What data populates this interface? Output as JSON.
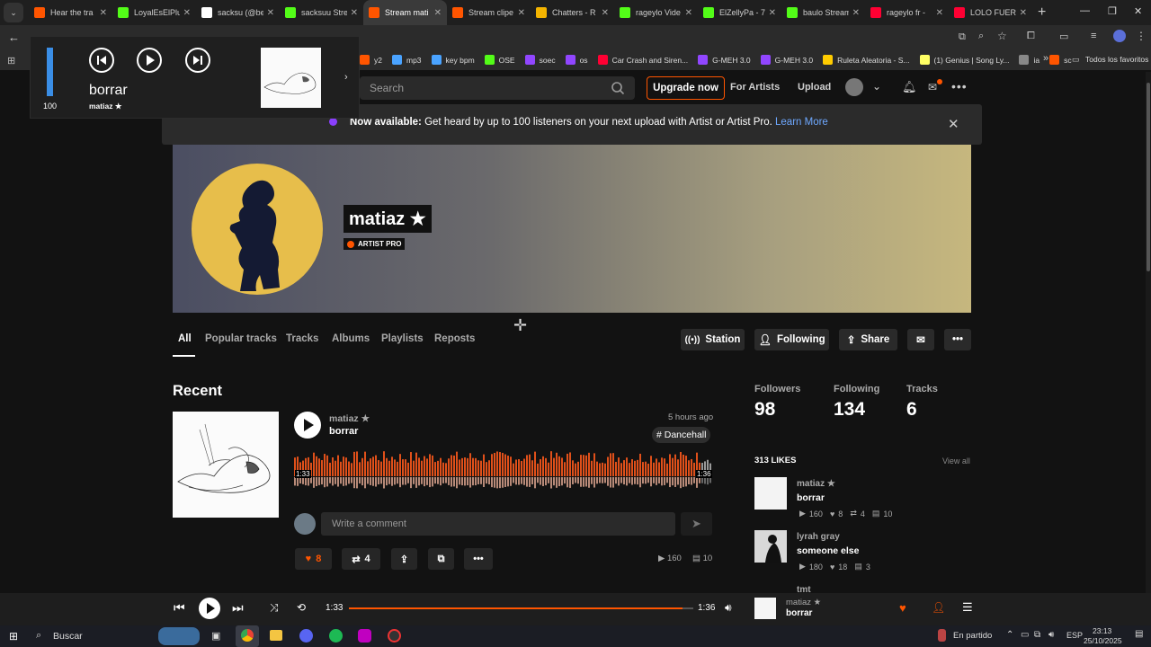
{
  "browser": {
    "tabs": [
      {
        "label": "Hear the tra",
        "color": "#ff5500"
      },
      {
        "label": "LoyalEsElPlu",
        "color": "#53fc18"
      },
      {
        "label": "sacksu (@be",
        "color": "#ffffff"
      },
      {
        "label": "sacksuu Stre",
        "color": "#53fc18"
      },
      {
        "label": "Stream mati",
        "color": "#ff5500"
      },
      {
        "label": "Stream clipe",
        "color": "#ff5500"
      },
      {
        "label": "Chatters - R",
        "color": "#f4b400"
      },
      {
        "label": "rageylo Vide",
        "color": "#53fc18"
      },
      {
        "label": "ElZellyPa - 7",
        "color": "#53fc18"
      },
      {
        "label": "baulo Stream",
        "color": "#53fc18"
      },
      {
        "label": "rageylo fr - ",
        "color": "#ff0033"
      },
      {
        "label": "LOLO FUERA",
        "color": "#ff0033"
      }
    ],
    "bookmarks": [
      {
        "label": "y2",
        "color": "#ff5500"
      },
      {
        "label": "mp3",
        "color": "#4aa3ff"
      },
      {
        "label": "key bpm",
        "color": "#4aa3ff"
      },
      {
        "label": "OSE",
        "color": "#53fc18"
      },
      {
        "label": "soec",
        "color": "#9146ff"
      },
      {
        "label": "os",
        "color": "#9146ff"
      },
      {
        "label": "Car Crash and Siren...",
        "color": "#ff0033"
      },
      {
        "label": "G-MEH 3.0",
        "color": "#9146ff"
      },
      {
        "label": "G-MEH 3.0",
        "color": "#9146ff"
      },
      {
        "label": "Ruleta Aleatoria - S...",
        "color": "#ffcc00"
      },
      {
        "label": "(1) Genius | Song Ly...",
        "color": "#ffff64"
      },
      {
        "label": "ia",
        "color": "#888888"
      },
      {
        "label": "sc",
        "color": "#ff5500"
      }
    ],
    "bookmarks_more": "»",
    "all_bookmarks": "Todos los favoritos"
  },
  "media_overlay": {
    "volume": "100",
    "title": "borrar",
    "artist": "matiaz ★",
    "volume_level": 1.0
  },
  "header": {
    "search_placeholder": "Search",
    "upgrade": "Upgrade now",
    "for_artists": "For Artists",
    "upload": "Upload"
  },
  "notice": {
    "bold": "Now available:",
    "text": " Get heard by up to 100 listeners on your next upload with Artist or Artist Pro. ",
    "link": "Learn More"
  },
  "profile": {
    "name": "matiaz ★",
    "badge": "ARTIST PRO",
    "tabs": [
      "All",
      "Popular tracks",
      "Tracks",
      "Albums",
      "Playlists",
      "Reposts"
    ],
    "station": "Station",
    "following_btn": "Following",
    "share": "Share"
  },
  "recent": {
    "title": "Recent",
    "artist": "matiaz ★",
    "track": "borrar",
    "time_ago": "5 hours ago",
    "tag": "# Dancehall",
    "time_current": "1:33",
    "time_total": "1:36",
    "comment_placeholder": "Write a comment",
    "likes": "8",
    "reposts": "4",
    "plays": "160",
    "comments": "10"
  },
  "stats": {
    "followers_label": "Followers",
    "followers": "98",
    "following_label": "Following",
    "following": "134",
    "tracks_label": "Tracks",
    "tracks": "6",
    "likes_title": "313 LIKES",
    "view_all": "View all"
  },
  "likes": [
    {
      "artist": "matiaz ★",
      "title": "borrar",
      "plays": "160",
      "likes": "8",
      "reposts": "4",
      "comments": "10"
    },
    {
      "artist": "lyrah gray",
      "title": "someone else",
      "plays": "180",
      "likes": "18",
      "comments": "3"
    },
    {
      "artist": "tmt"
    }
  ],
  "player": {
    "current": "1:33",
    "total": "1:36",
    "progress": 0.969,
    "artist": "matiaz ★",
    "title": "borrar"
  },
  "taskbar": {
    "search": "Buscar",
    "status": "En partido",
    "lang": "ESP",
    "time": "23:13",
    "date": "25/10/2025"
  }
}
